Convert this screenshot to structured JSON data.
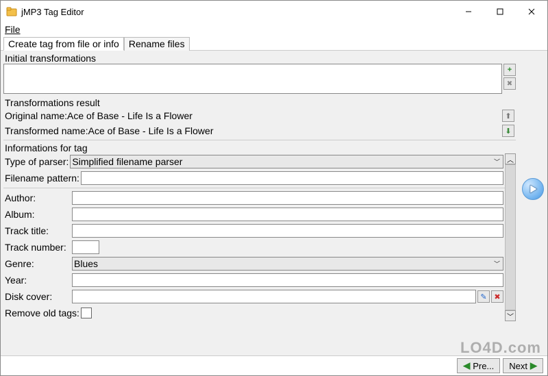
{
  "window": {
    "title": "jMP3 Tag Editor"
  },
  "menu": {
    "file": "File"
  },
  "tabs": {
    "create": "Create tag from file or info",
    "rename": "Rename files"
  },
  "transforms": {
    "initial_label": "Initial transformations",
    "result_label": "Transformations result",
    "original_label": "Original name:",
    "original_value": "Ace of Base - Life Is a Flower",
    "transformed_label": "Transformed name:",
    "transformed_value": "Ace of Base - Life Is a Flower"
  },
  "tag_info": {
    "section_label": "Informations for tag",
    "parser_label": "Type of parser:",
    "parser_value": "Simplified filename parser",
    "pattern_label": "Filename pattern:",
    "author_label": "Author:",
    "album_label": "Album:",
    "title_label": "Track title:",
    "number_label": "Track number:",
    "genre_label": "Genre:",
    "genre_value": "Blues",
    "year_label": "Year:",
    "cover_label": "Disk cover:",
    "remove_label": "Remove old tags:"
  },
  "buttons": {
    "prev": "Pre...",
    "next": "Next"
  },
  "icons": {
    "add": "+",
    "remove": "✖",
    "up": "⬆",
    "down": "⬇",
    "edit": "✎",
    "delete": "✖"
  },
  "watermark": "LO4D.com"
}
